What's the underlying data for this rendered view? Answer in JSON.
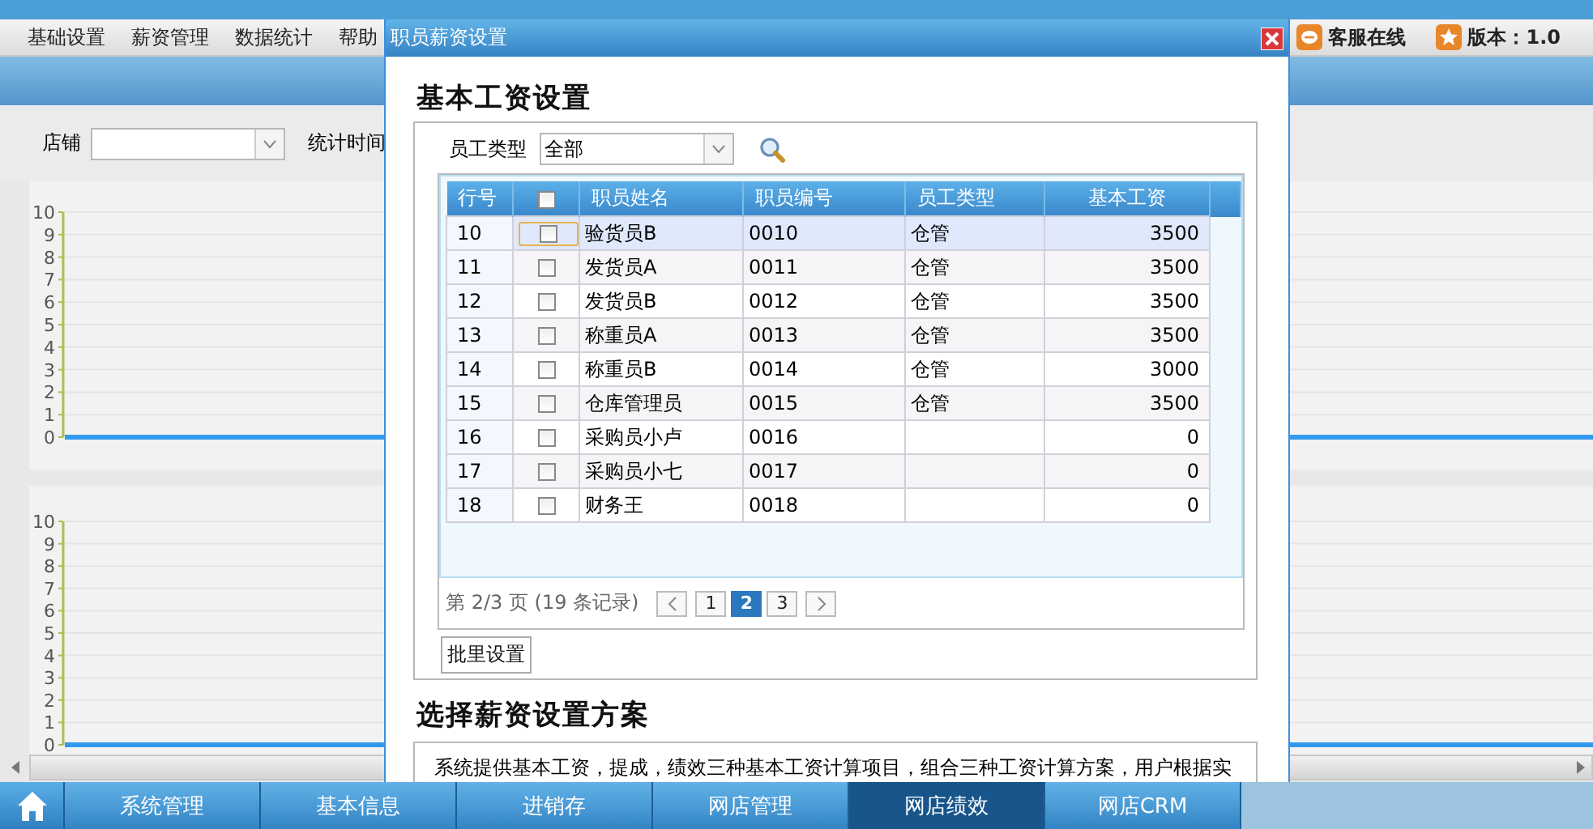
{
  "menu": [
    {
      "label": "基础设置"
    },
    {
      "label": "薪资管理"
    },
    {
      "label": "数据统计"
    },
    {
      "label": "帮助"
    }
  ],
  "status": {
    "service": "客服在线",
    "version": "版本：1.0"
  },
  "filters": {
    "shop_label": "店铺",
    "time_label": "统计时间"
  },
  "charts": [
    {
      "axis_labels": [
        "10",
        "9",
        "8",
        "7",
        "6",
        "5",
        "4",
        "3",
        "2",
        "1",
        "0"
      ]
    },
    {
      "axis_labels": [
        "10",
        "9",
        "8",
        "7",
        "6",
        "5",
        "4",
        "3",
        "2",
        "1",
        "0"
      ]
    }
  ],
  "dialog": {
    "title": "职员薪资设置",
    "section_title": "基本工资设置",
    "type_filter": {
      "label": "员工类型",
      "value": "全部"
    },
    "table": {
      "columns": [
        "行号",
        "职员姓名",
        "职员编号",
        "员工类型",
        "基本工资"
      ],
      "select_all_checked": false,
      "rows": [
        {
          "row_no": "10",
          "name": "验货员B",
          "code": "0010",
          "type": "仓管",
          "salary": "3500",
          "checked": false,
          "selected": true
        },
        {
          "row_no": "11",
          "name": "发货员A",
          "code": "0011",
          "type": "仓管",
          "salary": "3500",
          "checked": false,
          "selected": false
        },
        {
          "row_no": "12",
          "name": "发货员B",
          "code": "0012",
          "type": "仓管",
          "salary": "3500",
          "checked": false,
          "selected": false
        },
        {
          "row_no": "13",
          "name": "称重员A",
          "code": "0013",
          "type": "仓管",
          "salary": "3500",
          "checked": false,
          "selected": false
        },
        {
          "row_no": "14",
          "name": "称重员B",
          "code": "0014",
          "type": "仓管",
          "salary": "3000",
          "checked": false,
          "selected": false
        },
        {
          "row_no": "15",
          "name": "仓库管理员",
          "code": "0015",
          "type": "仓管",
          "salary": "3500",
          "checked": false,
          "selected": false
        },
        {
          "row_no": "16",
          "name": "采购员小卢",
          "code": "0016",
          "salary": "0",
          "checked": false,
          "selected": false
        },
        {
          "row_no": "17",
          "name": "采购员小七",
          "code": "0017",
          "salary": "0",
          "checked": false,
          "selected": false
        },
        {
          "row_no": "18",
          "name": "财务王",
          "code": "0018",
          "salary": "0",
          "checked": false,
          "selected": false
        }
      ]
    },
    "pager": {
      "summary": "第 2/3 页 (19 条记录)",
      "pages": [
        {
          "label": "1",
          "selected": false
        },
        {
          "label": "2",
          "selected": true
        },
        {
          "label": "3",
          "selected": false
        }
      ]
    },
    "batch_button": "批里设置",
    "scheme_title": "选择薪资设置方案",
    "scheme_text": "系统提供基本工资，提成，绩效三种基本工资计算项目，组合三种工资计算方案，用户根据实"
  },
  "taskbar": [
    {
      "label": "系统管理",
      "selected": false
    },
    {
      "label": "基本信息",
      "selected": false
    },
    {
      "label": "进销存",
      "selected": false
    },
    {
      "label": "网店管理",
      "selected": false
    },
    {
      "label": "网店绩效",
      "selected": true
    },
    {
      "label": "网店CRM",
      "selected": false
    }
  ]
}
